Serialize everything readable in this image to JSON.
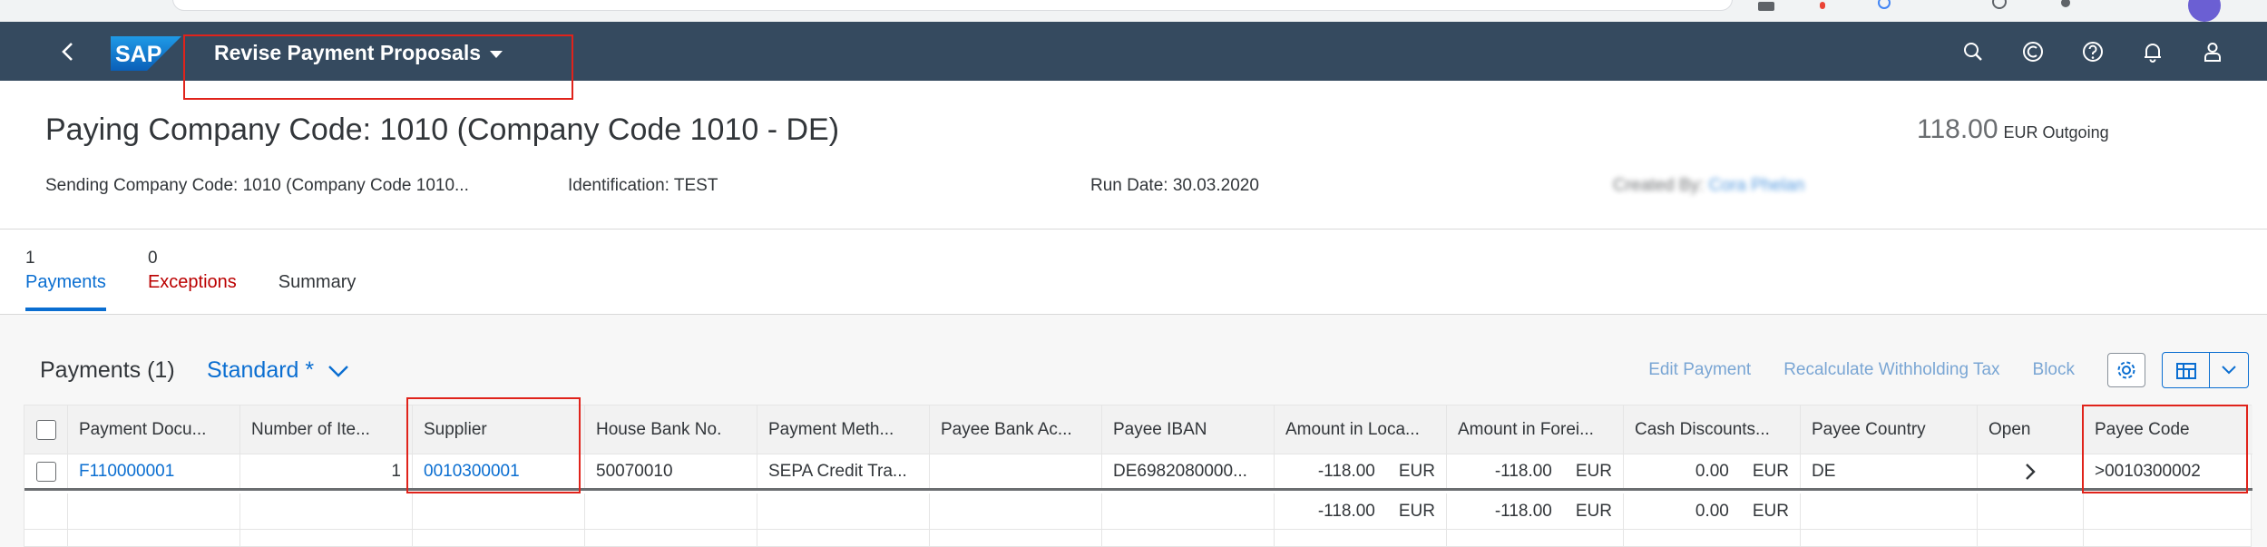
{
  "shell": {
    "app_title": "Revise Payment Proposals",
    "logo_text": "SAP"
  },
  "header": {
    "title": "Paying Company Code: 1010 (Company Code 1010 - DE)",
    "kpi_amount": "118.00",
    "kpi_unit": "EUR Outgoing",
    "attributes": {
      "sending": "Sending Company Code: 1010 (Company Code 1010...",
      "identification": "Identification: TEST",
      "run_date": "Run Date: 30.03.2020",
      "created_by_label": "Created By:",
      "created_by_value": "Cora Phelan"
    }
  },
  "tabs": [
    {
      "count": "1",
      "label": "Payments"
    },
    {
      "count": "0",
      "label": "Exceptions"
    },
    {
      "count": "",
      "label": "Summary"
    }
  ],
  "table": {
    "title": "Payments (1)",
    "variant": "Standard *",
    "actions": {
      "edit": "Edit Payment",
      "recalc": "Recalculate Withholding Tax",
      "block": "Block"
    },
    "columns": [
      "Payment Docu...",
      "Number of Ite...",
      "Supplier",
      "House Bank No.",
      "Payment Meth...",
      "Payee Bank Ac...",
      "Payee IBAN",
      "Amount in Loca...",
      "Amount in Forei...",
      "Cash Discounts...",
      "Payee Country",
      "Open",
      "Payee Code"
    ],
    "row": {
      "payment_doc": "F110000001",
      "num_items": "1",
      "supplier": "0010300001",
      "house_bank": "50070010",
      "payment_method": "SEPA Credit Tra...",
      "payee_bank_acct": "",
      "payee_iban": "DE6982080000...",
      "amount_local": "-118.00",
      "amount_local_cur": "EUR",
      "amount_foreign": "-118.00",
      "amount_foreign_cur": "EUR",
      "cash_discount": "0.00",
      "cash_discount_cur": "EUR",
      "payee_country": "DE",
      "payee_code": ">0010300002"
    },
    "totals": {
      "amount_local": "-118.00",
      "amount_local_cur": "EUR",
      "amount_foreign": "-118.00",
      "amount_foreign_cur": "EUR",
      "cash_discount": "0.00",
      "cash_discount_cur": "EUR"
    }
  },
  "colors": {
    "shell": "#354a5f",
    "link": "#0a6ed1",
    "error": "#bb0000",
    "highlight": "#e0231b"
  }
}
